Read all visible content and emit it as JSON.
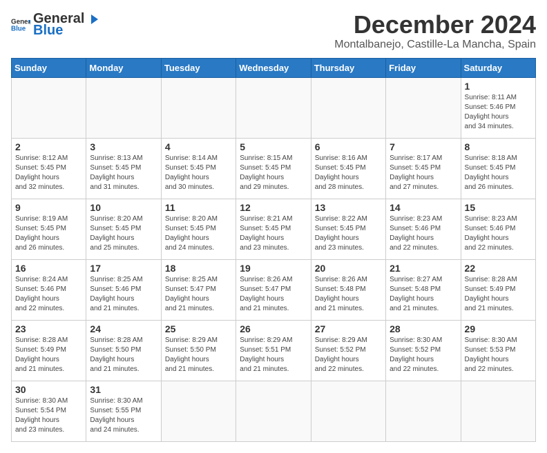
{
  "header": {
    "logo_general": "General",
    "logo_blue": "Blue",
    "month_title": "December 2024",
    "location": "Montalbanejo, Castille-La Mancha, Spain"
  },
  "weekdays": [
    "Sunday",
    "Monday",
    "Tuesday",
    "Wednesday",
    "Thursday",
    "Friday",
    "Saturday"
  ],
  "days": [
    {
      "num": "",
      "info": ""
    },
    {
      "num": "",
      "info": ""
    },
    {
      "num": "",
      "info": ""
    },
    {
      "num": "",
      "info": ""
    },
    {
      "num": "",
      "info": ""
    },
    {
      "num": "",
      "info": ""
    },
    {
      "num": "1",
      "sunrise": "8:11 AM",
      "sunset": "5:46 PM",
      "daylight": "9 hours and 34 minutes."
    },
    {
      "num": "2",
      "sunrise": "8:12 AM",
      "sunset": "5:45 PM",
      "daylight": "9 hours and 32 minutes."
    },
    {
      "num": "3",
      "sunrise": "8:13 AM",
      "sunset": "5:45 PM",
      "daylight": "9 hours and 31 minutes."
    },
    {
      "num": "4",
      "sunrise": "8:14 AM",
      "sunset": "5:45 PM",
      "daylight": "9 hours and 30 minutes."
    },
    {
      "num": "5",
      "sunrise": "8:15 AM",
      "sunset": "5:45 PM",
      "daylight": "9 hours and 29 minutes."
    },
    {
      "num": "6",
      "sunrise": "8:16 AM",
      "sunset": "5:45 PM",
      "daylight": "9 hours and 28 minutes."
    },
    {
      "num": "7",
      "sunrise": "8:17 AM",
      "sunset": "5:45 PM",
      "daylight": "9 hours and 27 minutes."
    },
    {
      "num": "8",
      "sunrise": "8:18 AM",
      "sunset": "5:45 PM",
      "daylight": "9 hours and 26 minutes."
    },
    {
      "num": "9",
      "sunrise": "8:19 AM",
      "sunset": "5:45 PM",
      "daylight": "9 hours and 26 minutes."
    },
    {
      "num": "10",
      "sunrise": "8:20 AM",
      "sunset": "5:45 PM",
      "daylight": "9 hours and 25 minutes."
    },
    {
      "num": "11",
      "sunrise": "8:20 AM",
      "sunset": "5:45 PM",
      "daylight": "9 hours and 24 minutes."
    },
    {
      "num": "12",
      "sunrise": "8:21 AM",
      "sunset": "5:45 PM",
      "daylight": "9 hours and 23 minutes."
    },
    {
      "num": "13",
      "sunrise": "8:22 AM",
      "sunset": "5:45 PM",
      "daylight": "9 hours and 23 minutes."
    },
    {
      "num": "14",
      "sunrise": "8:23 AM",
      "sunset": "5:46 PM",
      "daylight": "9 hours and 22 minutes."
    },
    {
      "num": "15",
      "sunrise": "8:23 AM",
      "sunset": "5:46 PM",
      "daylight": "9 hours and 22 minutes."
    },
    {
      "num": "16",
      "sunrise": "8:24 AM",
      "sunset": "5:46 PM",
      "daylight": "9 hours and 22 minutes."
    },
    {
      "num": "17",
      "sunrise": "8:25 AM",
      "sunset": "5:46 PM",
      "daylight": "9 hours and 21 minutes."
    },
    {
      "num": "18",
      "sunrise": "8:25 AM",
      "sunset": "5:47 PM",
      "daylight": "9 hours and 21 minutes."
    },
    {
      "num": "19",
      "sunrise": "8:26 AM",
      "sunset": "5:47 PM",
      "daylight": "9 hours and 21 minutes."
    },
    {
      "num": "20",
      "sunrise": "8:26 AM",
      "sunset": "5:48 PM",
      "daylight": "9 hours and 21 minutes."
    },
    {
      "num": "21",
      "sunrise": "8:27 AM",
      "sunset": "5:48 PM",
      "daylight": "9 hours and 21 minutes."
    },
    {
      "num": "22",
      "sunrise": "8:28 AM",
      "sunset": "5:49 PM",
      "daylight": "9 hours and 21 minutes."
    },
    {
      "num": "23",
      "sunrise": "8:28 AM",
      "sunset": "5:49 PM",
      "daylight": "9 hours and 21 minutes."
    },
    {
      "num": "24",
      "sunrise": "8:28 AM",
      "sunset": "5:50 PM",
      "daylight": "9 hours and 21 minutes."
    },
    {
      "num": "25",
      "sunrise": "8:29 AM",
      "sunset": "5:50 PM",
      "daylight": "9 hours and 21 minutes."
    },
    {
      "num": "26",
      "sunrise": "8:29 AM",
      "sunset": "5:51 PM",
      "daylight": "9 hours and 21 minutes."
    },
    {
      "num": "27",
      "sunrise": "8:29 AM",
      "sunset": "5:52 PM",
      "daylight": "9 hours and 22 minutes."
    },
    {
      "num": "28",
      "sunrise": "8:30 AM",
      "sunset": "5:52 PM",
      "daylight": "9 hours and 22 minutes."
    },
    {
      "num": "29",
      "sunrise": "8:30 AM",
      "sunset": "5:53 PM",
      "daylight": "9 hours and 22 minutes."
    },
    {
      "num": "30",
      "sunrise": "8:30 AM",
      "sunset": "5:54 PM",
      "daylight": "9 hours and 23 minutes."
    },
    {
      "num": "31",
      "sunrise": "8:30 AM",
      "sunset": "5:55 PM",
      "daylight": "9 hours and 24 minutes."
    }
  ]
}
